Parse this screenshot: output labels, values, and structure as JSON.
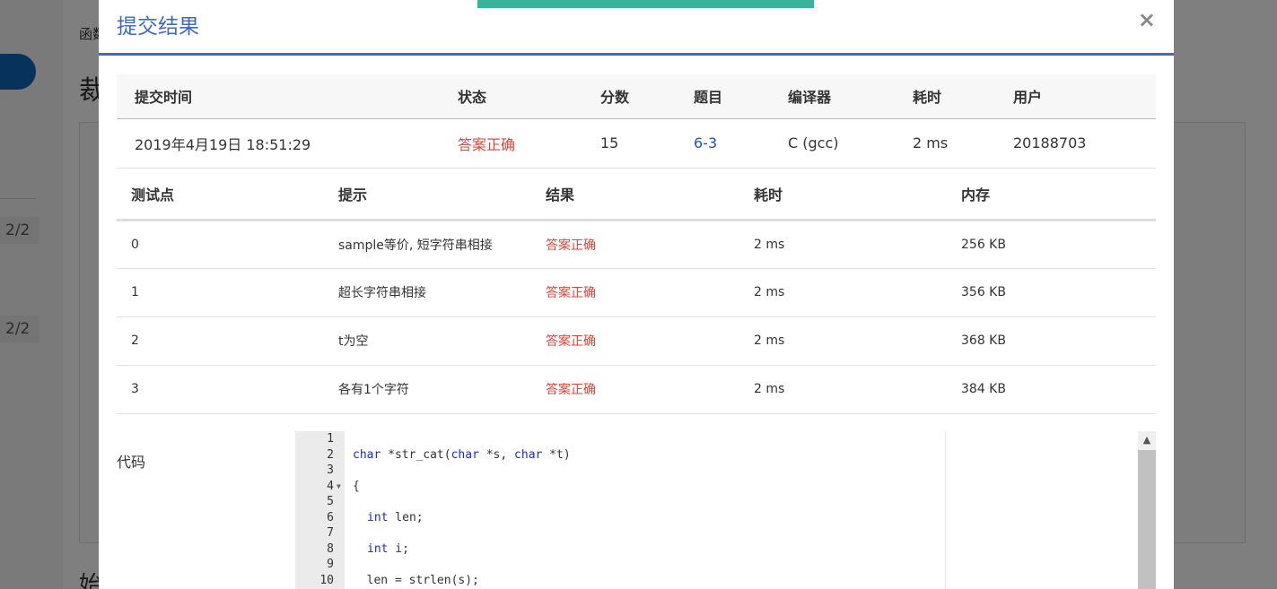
{
  "background": {
    "breadcrumb": "函数",
    "heading_fragment": "裁",
    "heading2_fragment": "始",
    "scores": [
      "2/2",
      "2/2"
    ]
  },
  "modal": {
    "title": "提交结果",
    "close_glyph": "×"
  },
  "submission": {
    "headers": [
      "提交时间",
      "状态",
      "分数",
      "题目",
      "编译器",
      "耗时",
      "用户"
    ],
    "row": {
      "time": "2019年4月19日 18:51:29",
      "status": "答案正确",
      "score": "15",
      "problem": "6-3",
      "compiler": "C (gcc)",
      "duration": "2 ms",
      "user": "20188703"
    }
  },
  "testcases": {
    "headers": [
      "测试点",
      "提示",
      "结果",
      "耗时",
      "内存"
    ],
    "rows": [
      {
        "id": "0",
        "hint": "sample等价, 短字符串相接",
        "result": "答案正确",
        "time": "2 ms",
        "memory": "256 KB"
      },
      {
        "id": "1",
        "hint": "超长字符串相接",
        "result": "答案正确",
        "time": "2 ms",
        "memory": "356 KB"
      },
      {
        "id": "2",
        "hint": "t为空",
        "result": "答案正确",
        "time": "2 ms",
        "memory": "368 KB"
      },
      {
        "id": "3",
        "hint": "各有1个字符",
        "result": "答案正确",
        "time": "2 ms",
        "memory": "384 KB"
      }
    ]
  },
  "code": {
    "label": "代码",
    "line_numbers": [
      "1",
      "2",
      "3",
      "4",
      "5",
      "6",
      "7",
      "8",
      "9",
      "10"
    ],
    "fold_line_marker": "▼",
    "lines": {
      "l2_kw1": "char",
      "l2_a": " *str_cat(",
      "l2_kw2": "char",
      "l2_b": " *s, ",
      "l2_kw3": "char",
      "l2_c": " *t)",
      "l4": "{",
      "l6_kw": "int",
      "l6_rest": " len;",
      "l8_kw": "int",
      "l8_rest": " i;",
      "l10": "  len = strlen(s);"
    }
  },
  "colors": {
    "accent": "#3d6bbf",
    "status_ok": "#d9463b",
    "toast": "#37b39c",
    "keyword": "#1b2fb4"
  }
}
